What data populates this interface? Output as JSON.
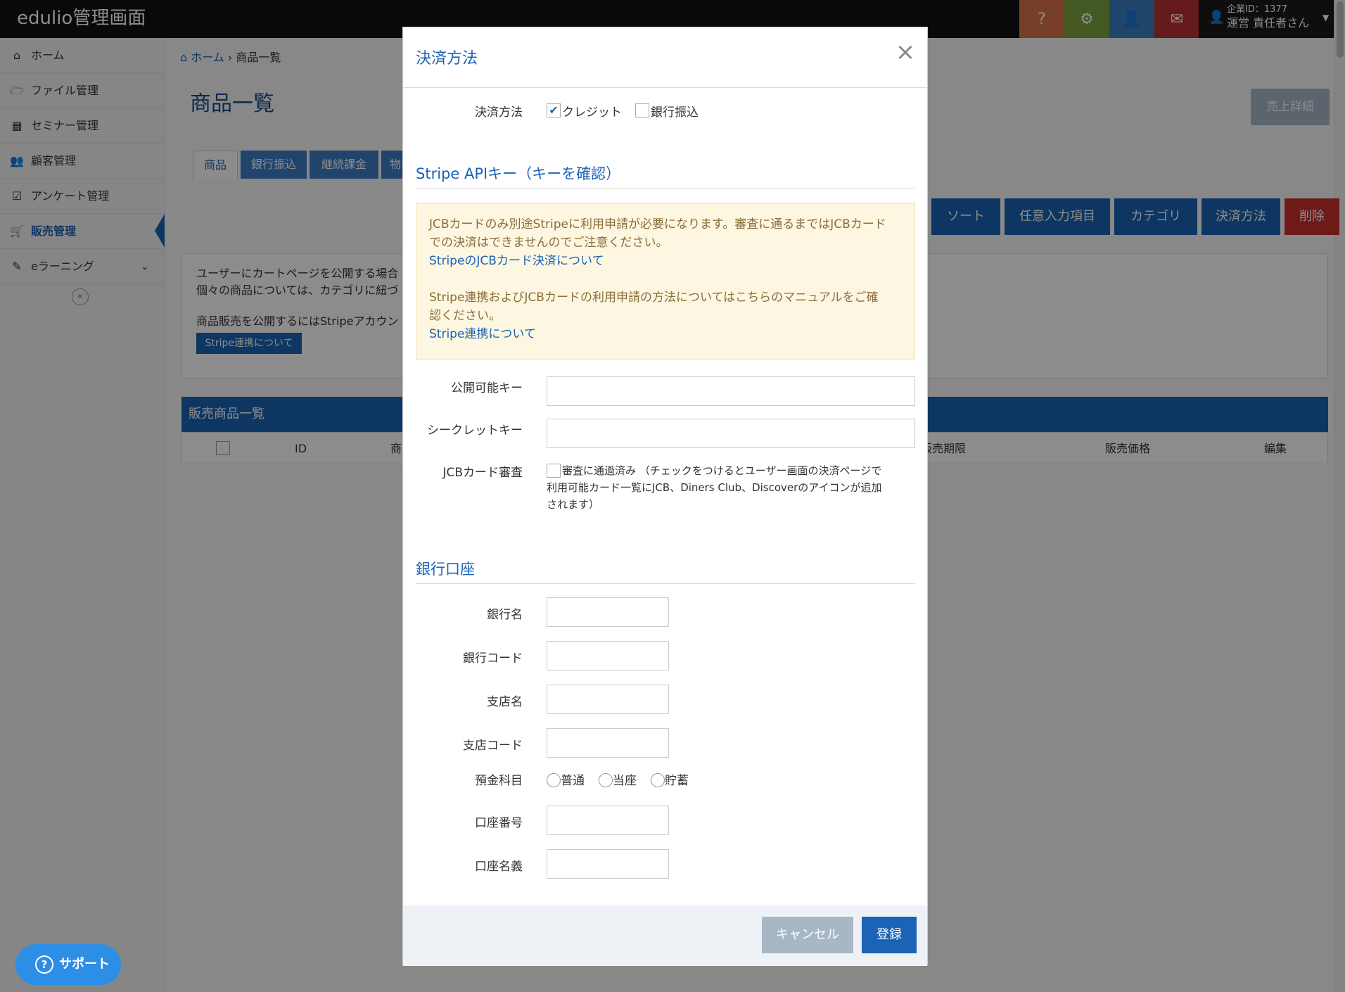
{
  "app": {
    "title": "edulio管理画面"
  },
  "header": {
    "company_id": "企業ID：1377",
    "user_name": "運営 責任者さん",
    "icons": [
      "question-icon",
      "gear-icon",
      "user-icon",
      "envelope-icon"
    ],
    "colors": {
      "help": "#d9734a",
      "settings": "#7ba33c",
      "profile": "#3a7ec2",
      "mail": "#b83232"
    }
  },
  "sidebar": {
    "items": [
      {
        "label": "ホーム",
        "icon": "home-icon"
      },
      {
        "label": "ファイル管理",
        "icon": "folder-icon"
      },
      {
        "label": "セミナー管理",
        "icon": "calendar-icon"
      },
      {
        "label": "顧客管理",
        "icon": "users-icon"
      },
      {
        "label": "アンケート管理",
        "icon": "checkbox-icon"
      },
      {
        "label": "販売管理",
        "icon": "cart-icon"
      },
      {
        "label": "eラーニング",
        "icon": "pencil-icon"
      }
    ],
    "active": "販売管理",
    "collapse": "«"
  },
  "breadcrumb": {
    "home": "ホーム",
    "current": "商品一覧"
  },
  "page": {
    "title": "商品一覧",
    "sales_detail": "売上詳細",
    "tabs": [
      "商品",
      "銀行振込",
      "継続課金",
      "物"
    ],
    "actions": [
      "ソート",
      "任意入力項目",
      "カテゴリ",
      "決済方法",
      "削除"
    ],
    "info_line1": "ユーザーにカートページを公開する場合",
    "info_line2": "個々の商品については、カテゴリに紐づ",
    "info_line3": "商品販売を公開するにはStripeアカウン",
    "stripe_button": "Stripe連携について",
    "list_title": "販売商品一覧",
    "columns": [
      "ID",
      "商",
      "販売期限",
      "販売価格",
      "編集"
    ]
  },
  "modal": {
    "title": "決済方法",
    "payment_label": "決済方法",
    "credit_label": "クレジット",
    "credit_checked": true,
    "bank_label": "銀行振込",
    "bank_checked": false,
    "stripe_section": "Stripe APIキー（キーを確認）",
    "notice_line1": "JCBカードのみ別途Stripeに利用申請が必要になります。審査に通るまではJCBカード",
    "notice_line2": "での決済はできませんのでご注意ください。",
    "notice_link1": "StripeのJCBカード決済について",
    "notice_line3": "Stripe連携およびJCBカードの利用申請の方法についてはこちらのマニュアルをご確",
    "notice_line4": "認ください。",
    "notice_link2": "Stripe連携について",
    "public_key_label": "公開可能キー",
    "public_key_value": "",
    "secret_key_label": "シークレットキー",
    "secret_key_value": "",
    "jcb_label": "JCBカード審査",
    "jcb_check": "審査に通過済み",
    "jcb_desc_1": "（チェックをつけるとユーザー画面の決済ページで",
    "jcb_desc_2": "利用可能カード一覧にJCB、Diners Club、Discoverのアイコンが追加",
    "jcb_desc_3": "されます）",
    "bank_section": "銀行口座",
    "fields": [
      {
        "label": "銀行名",
        "value": ""
      },
      {
        "label": "銀行コード",
        "value": ""
      },
      {
        "label": "支店名",
        "value": ""
      },
      {
        "label": "支店コード",
        "value": ""
      }
    ],
    "account_type_label": "預金科目",
    "account_types": [
      "普通",
      "当座",
      "貯蓄"
    ],
    "account_number_label": "口座番号",
    "account_name_label": "口座名義",
    "cancel": "キャンセル",
    "submit": "登録"
  },
  "support": {
    "label": "サポート"
  }
}
